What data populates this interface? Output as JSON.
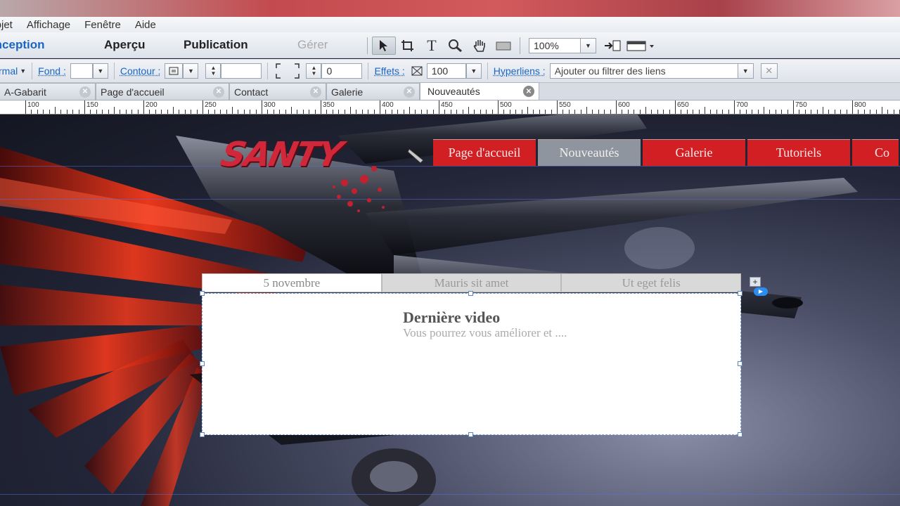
{
  "menu": [
    "Objet",
    "Affichage",
    "Fenêtre",
    "Aide"
  ],
  "modes": {
    "conception": "Conception",
    "apercu": "Aperçu",
    "publication": "Publication",
    "gerer": "Gérer"
  },
  "toolbar": {
    "zoom": "100%"
  },
  "props": {
    "format": "rmal",
    "fond_label": "Fond :",
    "contour_label": "Contour :",
    "stroke_value": "0",
    "effets_label": "Effets :",
    "opacity_value": "100",
    "hyperliens_label": "Hyperliens :",
    "hyperliens_placeholder": "Ajouter ou filtrer des liens"
  },
  "doc_tabs": [
    "A-Gabarit",
    "Page d'accueil",
    "Contact",
    "Galerie",
    "Nouveautés"
  ],
  "ruler_labels": [
    "100",
    "150",
    "200",
    "250",
    "300",
    "350",
    "400",
    "450",
    "500",
    "550",
    "600",
    "650",
    "700",
    "750",
    "800"
  ],
  "site": {
    "logo": "SANTY",
    "nav": [
      "Page d'accueil",
      "Nouveautés",
      "Galerie",
      "Tutoriels",
      "Co"
    ],
    "widget": {
      "tabs": [
        "5 novembre",
        "Mauris sit amet",
        "Ut eget felis"
      ],
      "title": "Dernière video",
      "text": "Vous pourrez vous améliorer et ...."
    }
  },
  "colors": {
    "accent": "#1a66c2",
    "nav_red": "#d21f23",
    "nav_active": "#8f959e"
  }
}
